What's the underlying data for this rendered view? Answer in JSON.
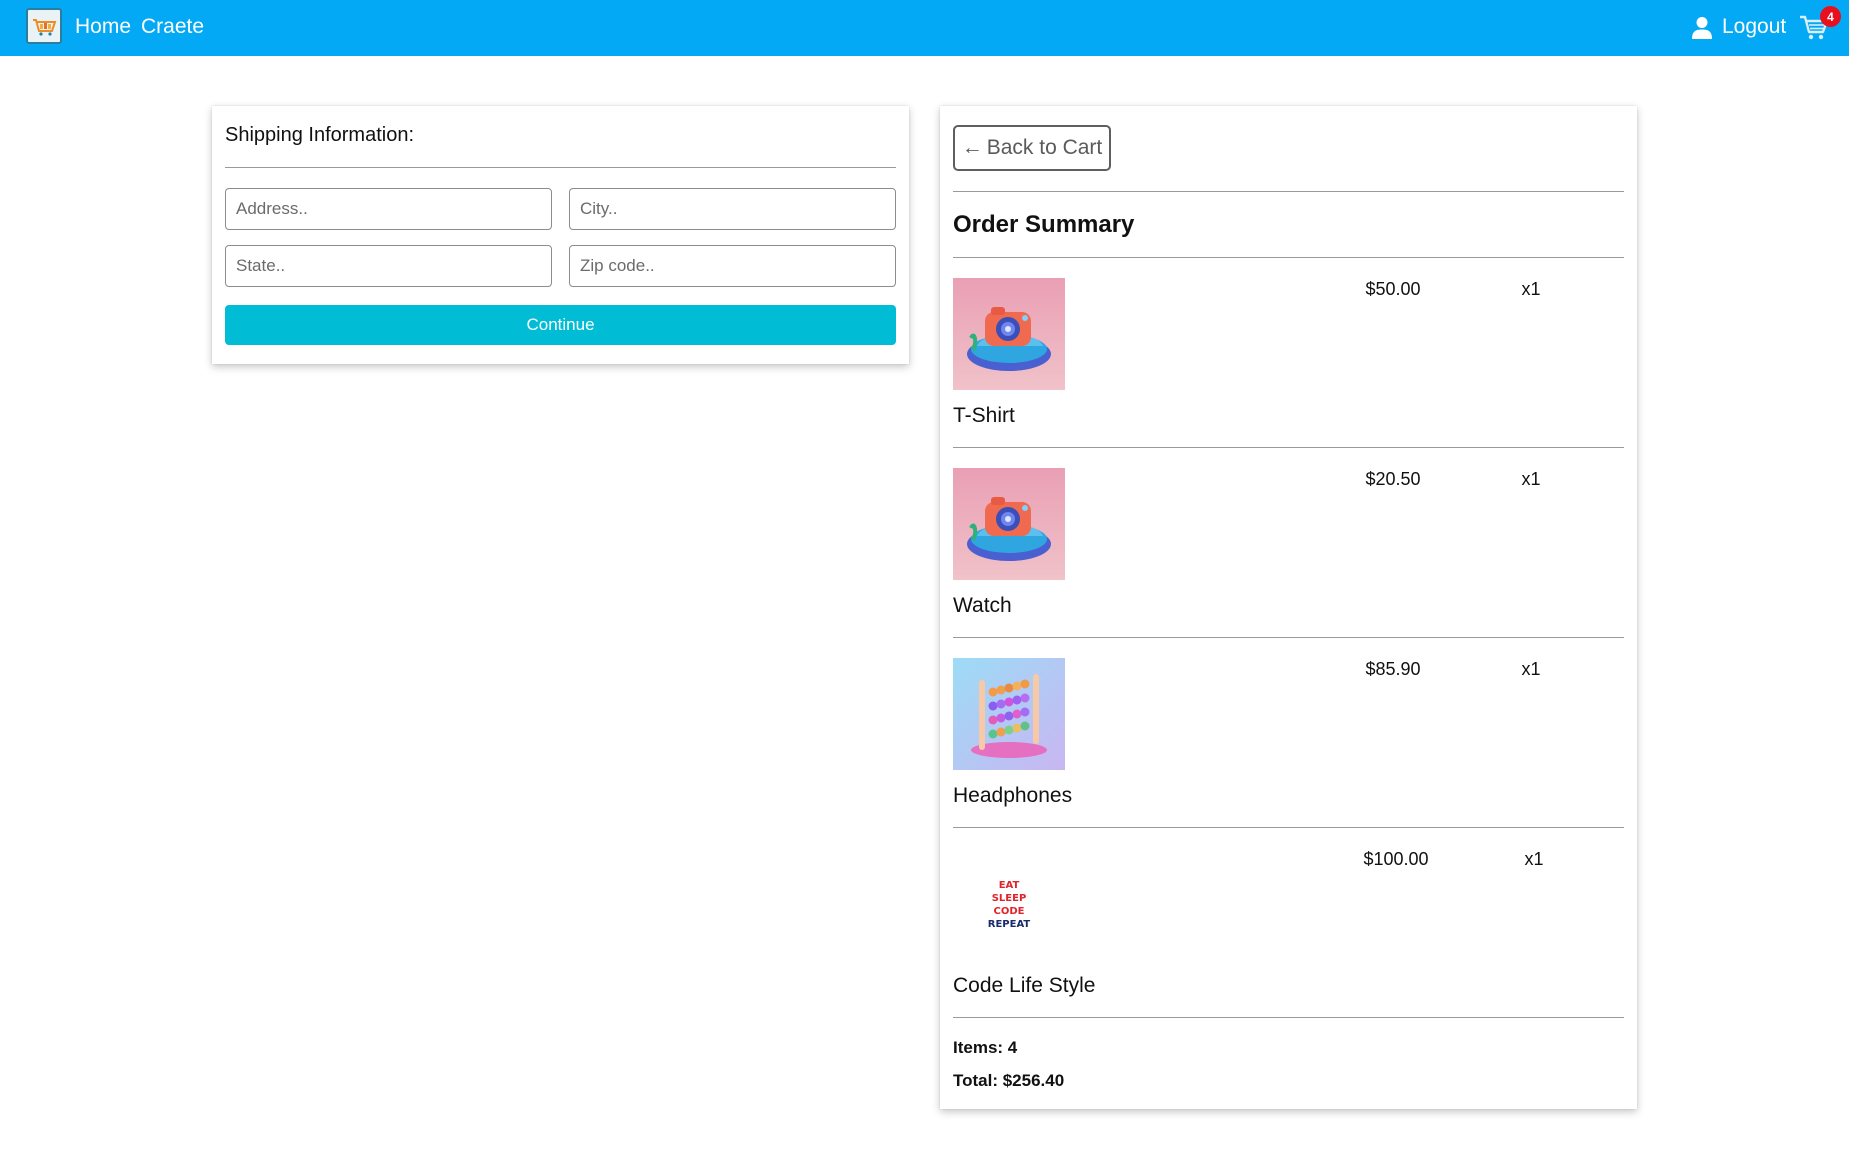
{
  "navbar": {
    "home_label": "Home",
    "create_label": "Craete",
    "logout_label": "Logout",
    "cart_count": "4",
    "bg_color": "#03a9f4",
    "badge_color": "#e8101e"
  },
  "shipping": {
    "title": "Shipping Information:",
    "address_placeholder": "Address..",
    "city_placeholder": "City..",
    "state_placeholder": "State..",
    "zip_placeholder": "Zip code..",
    "continue_label": "Continue",
    "button_color": "#00bcd4"
  },
  "summary": {
    "back_label": "Back to Cart",
    "title": "Order Summary",
    "items": [
      {
        "name": "T-Shirt",
        "price": "$50.00",
        "qty": "x1",
        "image": "camera-illustration"
      },
      {
        "name": "Watch",
        "price": "$20.50",
        "qty": "x1",
        "image": "camera-illustration"
      },
      {
        "name": "Headphones",
        "price": "$85.90",
        "qty": "x1",
        "image": "abacus-illustration"
      },
      {
        "name": "Code Life Style",
        "price": "$100.00",
        "qty": "x1",
        "image": "eat-sleep-code-repeat-print"
      }
    ],
    "items_label": "Items: 4",
    "total_label": "Total: $256.40",
    "print_text": [
      "EAT",
      "SLEEP",
      "CODE",
      "REPEAT"
    ]
  }
}
